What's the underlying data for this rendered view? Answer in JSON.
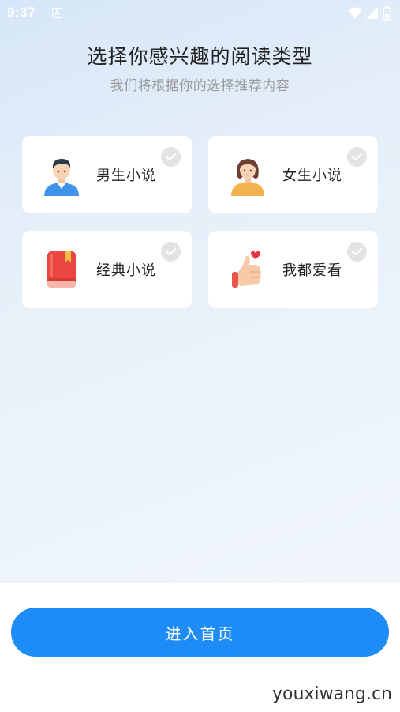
{
  "status_bar": {
    "time": "9:37",
    "notification_letter": "A"
  },
  "header": {
    "title": "选择你感兴趣的阅读类型",
    "subtitle": "我们将根据你的选择推荐内容"
  },
  "categories": [
    {
      "label": "男生小说",
      "icon": "boy-avatar-icon",
      "selected": false
    },
    {
      "label": "女生小说",
      "icon": "girl-avatar-icon",
      "selected": false
    },
    {
      "label": "经典小说",
      "icon": "red-book-icon",
      "selected": false
    },
    {
      "label": "我都爱看",
      "icon": "thumbs-up-heart-icon",
      "selected": false
    }
  ],
  "footer": {
    "enter_label": "进入首页"
  },
  "watermark": "youxiwang.cn",
  "colors": {
    "primary": "#1e8cf6",
    "check_unselected": "#e3e3e3"
  }
}
